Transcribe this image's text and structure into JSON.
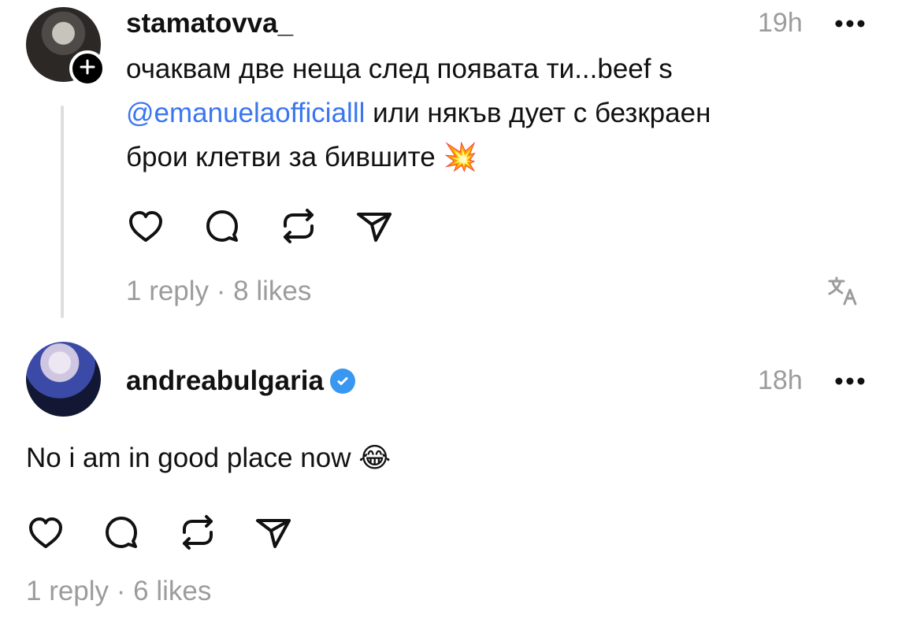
{
  "comments": [
    {
      "username": "stamatovva_",
      "time": "19h",
      "lines": [
        "очаквам две неща след появата ти...beef s",
        "@emanuelaofficialll",
        " или някъв дует с безкраен",
        "брои клетви за бившите",
        "💥"
      ],
      "meta": "1 reply · 8 likes"
    },
    {
      "username": "andreabulgaria",
      "time": "18h",
      "text": "No i am in good place now",
      "emoji": "😂",
      "meta": "1 reply · 6 likes"
    }
  ],
  "icons": {
    "more": "more-icon",
    "like": "heart-icon",
    "reply": "comment-icon",
    "repost": "repost-icon",
    "share": "send-icon",
    "translate": "translate-icon",
    "follow": "plus-icon",
    "verified": "verified-badge-icon"
  },
  "colors": {
    "text": "#111111",
    "muted": "#9c9c9c",
    "mention": "#3a76f0",
    "verified": "#3897f0",
    "thread_line": "#dedede"
  }
}
